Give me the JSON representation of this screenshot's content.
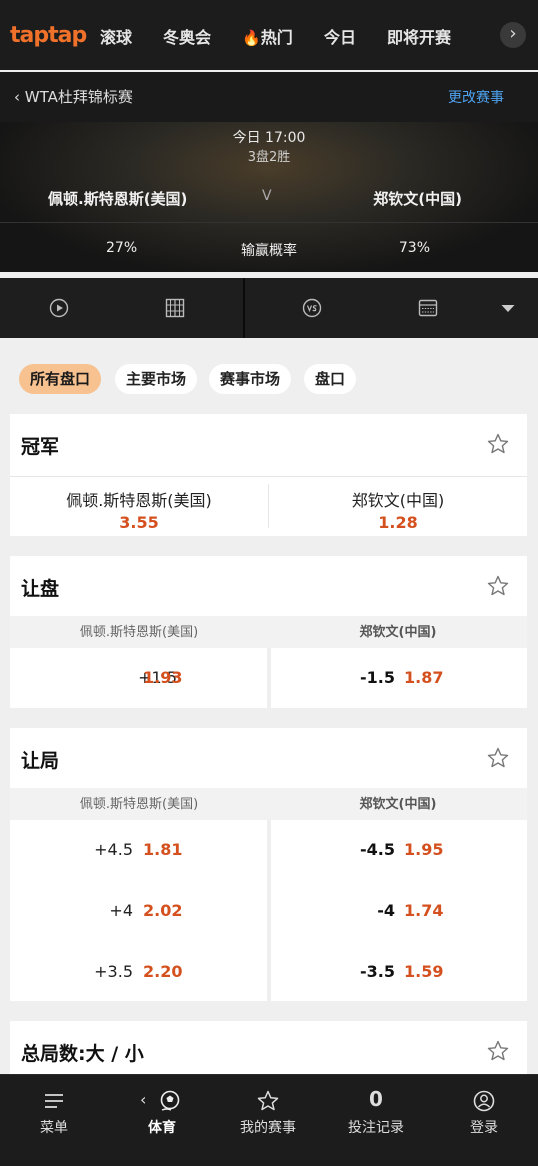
{
  "nav": {
    "logo": "taptap",
    "items": [
      "滚球",
      "冬奥会",
      "热门",
      "今日",
      "即将开赛"
    ],
    "more_arrow": "›"
  },
  "match_bar": {
    "back_label": "WTA杜拜锦标赛",
    "change_label": "更改赛事"
  },
  "hero": {
    "time": "今日 17:00",
    "format": "3盘2胜",
    "player1": "佩顿.斯特恩斯(美国)",
    "vs": "V",
    "player2": "郑钦文(中国)",
    "win_prob_label": "输赢概率",
    "player1_pct": "27%",
    "player2_pct": "73%"
  },
  "toolbar": {
    "icons": [
      "play-icon",
      "court-icon",
      "vs-icon",
      "scoreboard-icon",
      "dropdown-icon"
    ]
  },
  "filters": [
    "所有盘口",
    "主要市场",
    "赛事市场",
    "盘口"
  ],
  "markets": {
    "champion": {
      "title": "冠军",
      "p1": "佩顿.斯特恩斯(美国)",
      "p1_odds": "3.55",
      "p2": "郑钦文(中国)",
      "p2_odds": "1.28"
    },
    "handicap": {
      "title": "让盘",
      "p1": "佩顿.斯特恩斯(美国)",
      "p2": "郑钦文(中国)",
      "rows": [
        {
          "h1": "+1.5",
          "o1": "1.93",
          "h2": "-1.5",
          "o2": "1.87"
        }
      ]
    },
    "game_handicap": {
      "title": "让局",
      "p1": "佩顿.斯特恩斯(美国)",
      "p2": "郑钦文(中国)",
      "rows": [
        {
          "h1": "+4.5",
          "o1": "1.81",
          "h2": "-4.5",
          "o2": "1.95"
        },
        {
          "h1": "+4",
          "o1": "2.02",
          "h2": "-4",
          "o2": "1.74"
        },
        {
          "h1": "+3.5",
          "o1": "2.20",
          "h2": "-3.5",
          "o2": "1.59"
        }
      ]
    },
    "total_games": {
      "title": "总局数:大 / 小"
    }
  },
  "bottom_nav": {
    "menu": "菜单",
    "sports": "体育",
    "my_events": "我的赛事",
    "bet_count": "0",
    "bet_history": "投注记录",
    "login": "登录"
  },
  "colors": {
    "accent": "#f0712a",
    "odds": "#d4501e",
    "link": "#4da3f0",
    "chip_active": "#f7c28f"
  }
}
